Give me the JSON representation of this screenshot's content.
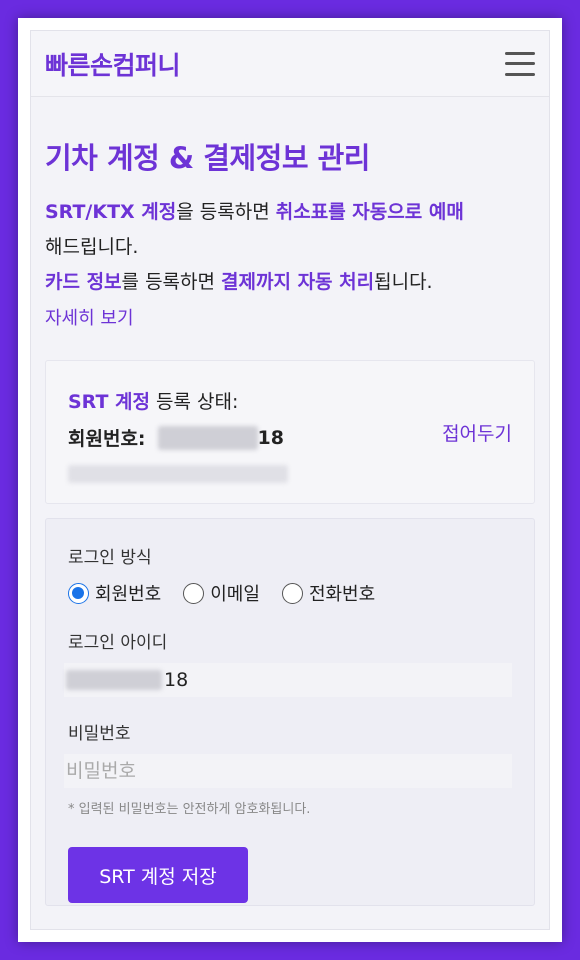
{
  "header": {
    "brand": "빠른손컴퍼니",
    "menu_icon": "hamburger-icon"
  },
  "main": {
    "title": "기차 계정 & 결제정보 관리",
    "desc": {
      "p1_hl1": "SRT/KTX 계정",
      "p1_t1": "을 등록하면 ",
      "p1_hl2": "취소표를 자동으로 예매",
      "p1_t2": "해드립니다.",
      "p2_hl1": "카드 정보",
      "p2_t1": "를 등록하면 ",
      "p2_hl2": "결제까지 자동 처리",
      "p2_t2": "됩니다."
    },
    "more_link": "자세히 보기"
  },
  "status": {
    "account_type": "SRT 계정",
    "label": " 등록 상태:",
    "member_label": "회원번호:",
    "member_suffix": "18",
    "collapse": "접어두기"
  },
  "form": {
    "login_method_label": "로그인 방식",
    "options": [
      "회원번호",
      "이메일",
      "전화번호"
    ],
    "selected": "회원번호",
    "id_label": "로그인 아이디",
    "id_value_suffix": "18",
    "password_label": "비밀번호",
    "password_placeholder": "비밀번호",
    "hint": "* 입력된 비밀번호는 안전하게 암호화됩니다.",
    "save_button": "SRT 계정 저장"
  },
  "colors": {
    "accent": "#6d33d6",
    "button": "#6d33e6",
    "background": "#6a2be0",
    "radio": "#1a73e8"
  }
}
